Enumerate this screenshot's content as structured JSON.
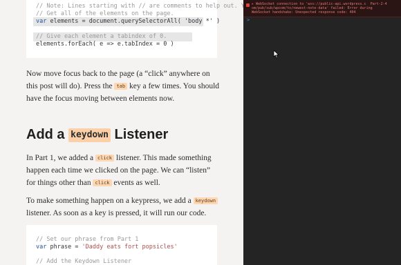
{
  "article": {
    "code_top": {
      "line1": "// Note: Lines starting with // are comments to help out. Y",
      "line2": "// Get all of the elements on the page.",
      "line3_kw": "var",
      "line3_rest": " elements = document.querySelectorAll( 'body *' )",
      "line4": "// Give each element a tabindex of 0.",
      "line5": "elements.forEach( e => e.tabIndex = 0 )"
    },
    "para1": {
      "text1": "Now move focus back to the page (a “click” anywhere on this post will do). Press the ",
      "tag": "tab",
      "text2": " key a few times. You should have the focus moving between elements now."
    },
    "heading": {
      "pre": "Add a ",
      "tag": "keydown",
      "post": " Listener"
    },
    "para2": {
      "text1": "In Part 1, we added a ",
      "tag1": "click",
      "text2": " listener. This made something happen each time we clicked on the page. We can “listen” for things other than ",
      "tag2": "click",
      "text3": " events as well."
    },
    "para3": {
      "text1": "To make something happen on a keypress, we add a ",
      "tag": "keydown",
      "text2": " listener. As soon as a key is pressed, it will run our code."
    },
    "code_bottom": {
      "line1": "// Set our phrase from Part 1",
      "line2_kw": "var",
      "line2_mid": " phrase = ",
      "line2_str": "'Daddy eats fort popsicles'",
      "line3": "// Add the Keydown Listener"
    }
  },
  "devtools": {
    "error_line1": "▸ WebSocket connection to 'wss://public-api.wordpress.c  Part-2-4",
    "error_line2": "om/pub/sub/wpcom/to/newest-note-data' failed: Error during",
    "error_line3": "WebSocket handshake: Unexpected response code: 404",
    "prompt": ">"
  },
  "colors": {
    "page_bg": "#f4f3f2",
    "devtools_bg": "#242424",
    "tag_bg": "#fbd7b4",
    "error_text": "#e27a72"
  }
}
